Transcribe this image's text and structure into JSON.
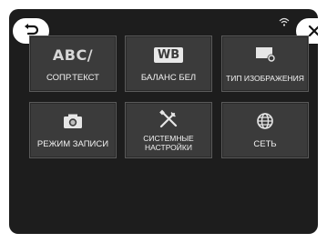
{
  "header": {
    "back_icon": "back-arrow-icon",
    "close_icon": "close-icon",
    "status_icon": "wifi-icon"
  },
  "menu": {
    "items": [
      {
        "label": "СОПР.ТЕКСТ",
        "icon": "abc-text-icon",
        "icon_text": "ABC/"
      },
      {
        "label": "БАЛАНС БЕЛ",
        "icon": "white-balance-icon",
        "icon_text": "WB"
      },
      {
        "label": "ТИП ИЗОБРАЖЕНИЯ",
        "icon": "picture-type-icon"
      },
      {
        "label": "РЕЖИМ ЗАПИСИ",
        "icon": "camera-icon"
      },
      {
        "label": "СИСТЕМНЫЕ\nНАСТРОЙКИ",
        "icon": "tools-icon"
      },
      {
        "label": "СЕТЬ",
        "icon": "globe-icon"
      }
    ]
  },
  "colors": {
    "screen_bg": "#1d1d1d",
    "tile_bg": "#3b3b3b",
    "text": "#f2f2f2"
  }
}
